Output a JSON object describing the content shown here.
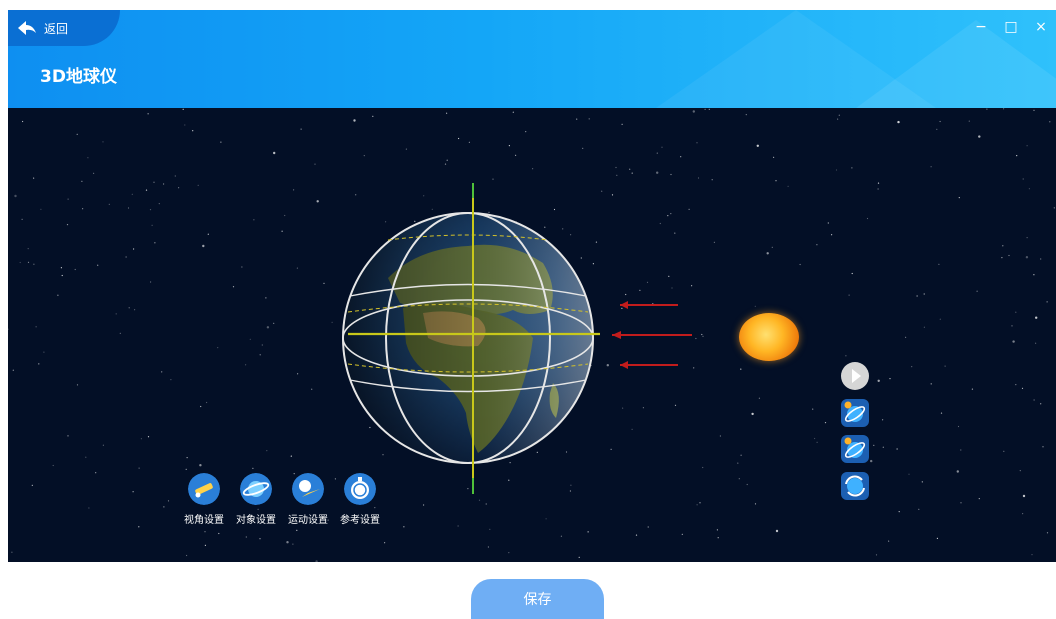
{
  "header": {
    "back_label": "返回",
    "title": "3D地球仪",
    "controls": {
      "minimize": "−",
      "maximize": "□",
      "close": "×"
    }
  },
  "toolbar": {
    "tools": [
      {
        "label": "视角设置",
        "icon": "telescope-icon"
      },
      {
        "label": "对象设置",
        "icon": "planet-icon"
      },
      {
        "label": "运动设置",
        "icon": "plane-icon"
      },
      {
        "label": "参考设置",
        "icon": "compass-icon"
      }
    ]
  },
  "side_buttons": [
    "play-icon",
    "orbit-icon",
    "orbit-icon",
    "rotate-icon"
  ],
  "footer": {
    "save_label": "保存"
  },
  "colors": {
    "header_start": "#0e8ff1",
    "header_end": "#2fc1fb",
    "stage_bg": "#030f26",
    "axis": "#c8c81a",
    "light_ray": "#c21c1c",
    "save_button": "#6faef4"
  }
}
